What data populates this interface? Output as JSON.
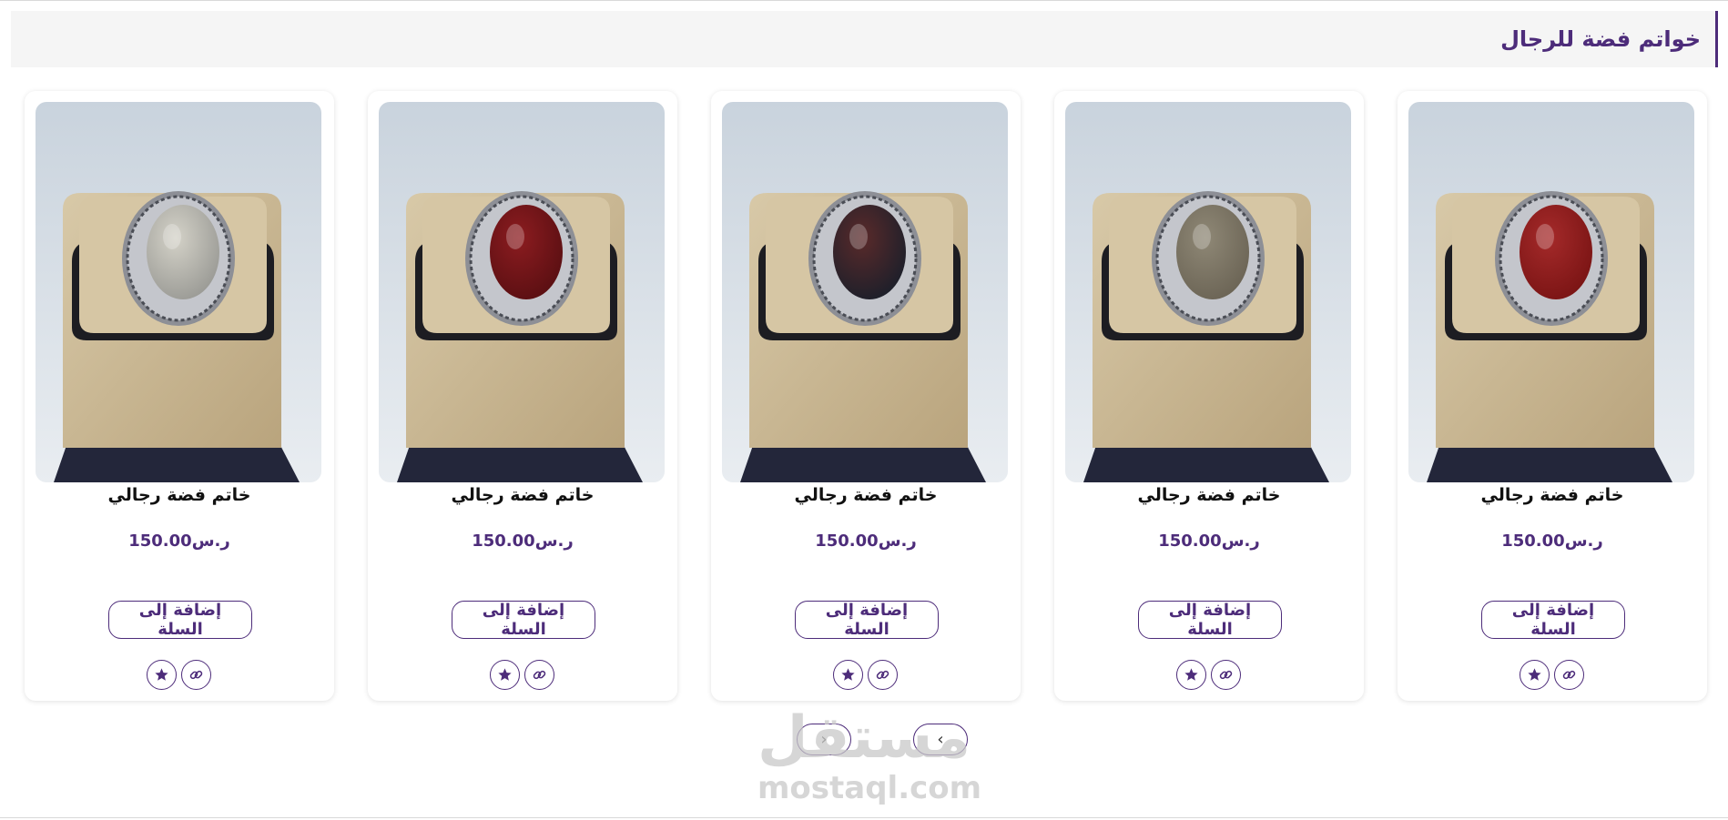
{
  "section": {
    "title": "خواتم فضة للرجال"
  },
  "products": [
    {
      "name": "خاتم فضة رجالي",
      "price": "ر.س150.00",
      "add_label": "إضافة إلى السلة",
      "stone_color": "#7a1414",
      "stone_highlight": "#a52a2a"
    },
    {
      "name": "خاتم فضة رجالي",
      "price": "ر.س150.00",
      "add_label": "إضافة إلى السلة",
      "stone_color": "#6b6455",
      "stone_highlight": "#8f8876"
    },
    {
      "name": "خاتم فضة رجالي",
      "price": "ر.س150.00",
      "add_label": "إضافة إلى السلة",
      "stone_color": "#1c1f2a",
      "stone_highlight": "#5a2a2a"
    },
    {
      "name": "خاتم فضة رجالي",
      "price": "ر.س150.00",
      "add_label": "إضافة إلى السلة",
      "stone_color": "#5a0f12",
      "stone_highlight": "#8c1c20"
    },
    {
      "name": "خاتم فضة رجالي",
      "price": "ر.س150.00",
      "add_label": "إضافة إلى السلة",
      "stone_color": "#9a9a95",
      "stone_highlight": "#d4d2c8"
    }
  ],
  "actions": {
    "favorite_icon": "star-icon",
    "share_icon": "link-icon"
  },
  "pagination": {
    "prev_icon": "chevron-right-icon",
    "next_icon": "chevron-left-icon",
    "prev_glyph": "‹",
    "next_glyph": "›"
  },
  "watermark": {
    "arabic": "مستقل",
    "latin": "mostaql.com"
  },
  "colors": {
    "accent": "#4d2c7a",
    "header_bg": "#f5f5f5",
    "card_bg": "#ffffff"
  }
}
